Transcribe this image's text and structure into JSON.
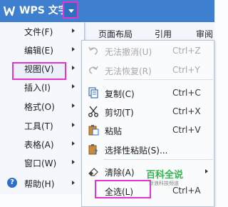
{
  "app": {
    "title": "WPS 文字",
    "logo_icon": "wps-w-logo"
  },
  "ribbon": {
    "tabs": [
      "页面布局",
      "引用",
      "审阅"
    ]
  },
  "main_menu": {
    "items": [
      {
        "label": "文件(F)",
        "has_submenu": true
      },
      {
        "label": "编辑(E)",
        "has_submenu": true,
        "highlighted": true
      },
      {
        "label": "视图(V)",
        "has_submenu": true
      },
      {
        "label": "插入(I)",
        "has_submenu": true
      },
      {
        "label": "格式(O)",
        "has_submenu": true
      },
      {
        "label": "工具(T)",
        "has_submenu": true
      },
      {
        "label": "表格(A)",
        "has_submenu": true
      },
      {
        "label": "窗口(W)",
        "has_submenu": true
      },
      {
        "label": "帮助(H)",
        "has_submenu": true,
        "icon": "help-icon"
      }
    ]
  },
  "edit_menu": {
    "items": [
      {
        "label": "无法撤消(U)",
        "shortcut": "Ctrl+Z",
        "icon": "undo-icon",
        "disabled": true
      },
      {
        "label": "无法恢复(R)",
        "shortcut": "Ctrl+Y",
        "icon": "redo-icon",
        "disabled": true
      },
      {
        "label": "复制(C)",
        "shortcut": "Ctrl+C",
        "icon": "copy-icon"
      },
      {
        "label": "剪切(T)",
        "shortcut": "Ctrl+X",
        "icon": "scissors-icon"
      },
      {
        "label": "粘贴",
        "shortcut": "Ctrl+V",
        "icon": "paste-icon"
      },
      {
        "label": "选择性粘贴(S)...",
        "shortcut": "",
        "icon": "paste-special-icon"
      },
      {
        "label": "清除(A)",
        "shortcut": "",
        "icon": "eraser-icon",
        "has_submenu": true
      },
      {
        "label": "全选(L)",
        "shortcut": "Ctrl+A",
        "icon": "",
        "highlighted": true
      }
    ]
  },
  "watermark": {
    "main": "百科全说",
    "sub": "新浪科技频道"
  },
  "colors": {
    "titlebar": "#3f7fcf",
    "highlight_border": "#e533d0",
    "watermark_green": "#33b54d"
  }
}
